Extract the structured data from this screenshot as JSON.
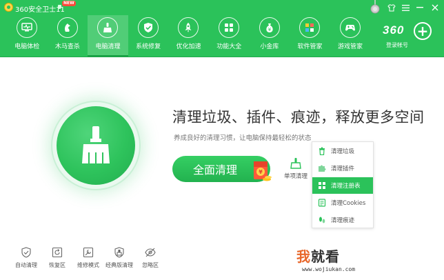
{
  "app": {
    "title": "360安全卫士11",
    "new_badge": "NEW"
  },
  "window_controls": [
    "medal-icon",
    "tshirt-icon",
    "menu-icon",
    "minimize-icon",
    "close-icon"
  ],
  "nav": [
    {
      "label": "电脑体检",
      "icon": "monitor-check-icon"
    },
    {
      "label": "木马查杀",
      "icon": "horse-icon"
    },
    {
      "label": "电脑清理",
      "icon": "broom-icon",
      "active": true
    },
    {
      "label": "系统修复",
      "icon": "shield-check-icon"
    },
    {
      "label": "优化加速",
      "icon": "rocket-icon"
    },
    {
      "label": "功能大全",
      "icon": "grid-icon"
    },
    {
      "label": "小金库",
      "icon": "money-bag-icon"
    },
    {
      "label": "软件管家",
      "icon": "apps-icon"
    },
    {
      "label": "游戏管家",
      "icon": "gamepad-icon"
    }
  ],
  "account": {
    "brand": "360",
    "login_label": "登录帐号"
  },
  "main": {
    "headline": "清理垃圾、插件、痕迹，释放更多空间",
    "subline": "养成良好的清理习惯，让电脑保持最轻松的状态",
    "clean_button": "全面清理",
    "single_clean": "单项清理"
  },
  "dropdown": [
    {
      "label": "清理垃圾",
      "icon": "trash-icon"
    },
    {
      "label": "清理插件",
      "icon": "puzzle-icon"
    },
    {
      "label": "清理注册表",
      "icon": "registry-icon",
      "highlighted": true
    },
    {
      "label": "清理Cookies",
      "icon": "cookie-icon"
    },
    {
      "label": "清理痕迹",
      "icon": "footprint-icon"
    }
  ],
  "bottom_tools": [
    {
      "label": "自动清理",
      "icon": "auto-clean-icon"
    },
    {
      "label": "恢复区",
      "icon": "restore-icon"
    },
    {
      "label": "维修模式",
      "icon": "repair-icon"
    },
    {
      "label": "经典版清理",
      "icon": "classic-icon"
    },
    {
      "label": "忽略区",
      "icon": "ignore-icon"
    }
  ],
  "watermark": {
    "prefix": "我",
    "main": "就看",
    "url": "www.wojiukan.com"
  },
  "colors": {
    "brand_green": "#2bc25a",
    "highlight_green": "#2bc25a",
    "accent_orange": "#e8672a"
  }
}
